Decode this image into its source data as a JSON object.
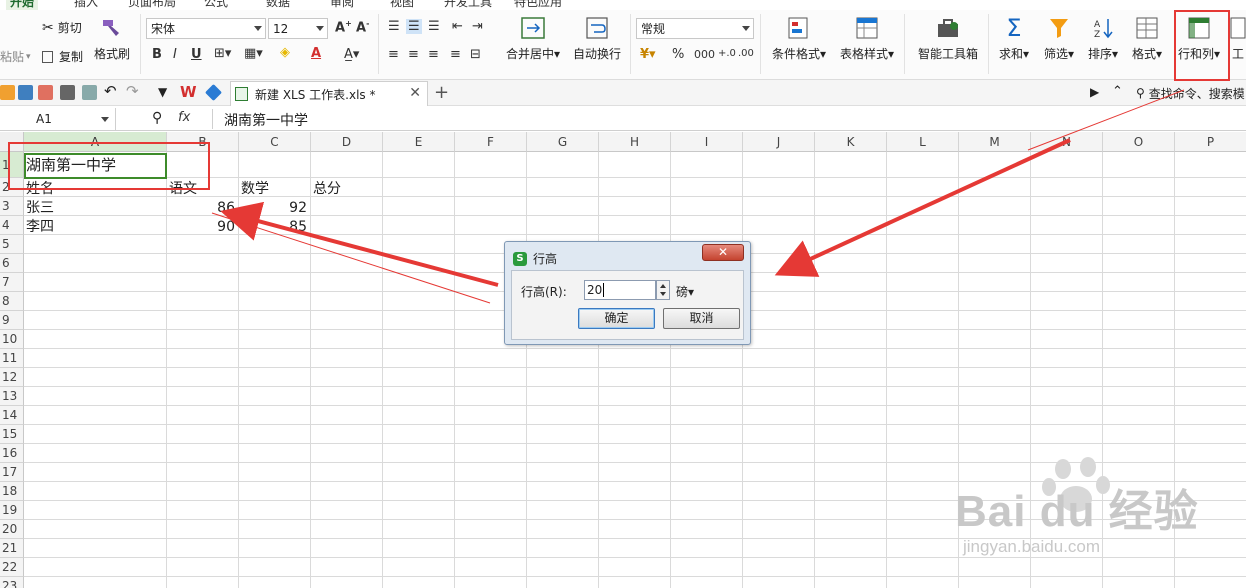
{
  "ribbon_tabs": [
    "开始",
    "插入",
    "页面布局",
    "公式",
    "数据",
    "审阅",
    "视图",
    "开发工具",
    "特色应用"
  ],
  "ribbon": {
    "cut": "剪切",
    "copy": "复制",
    "format_painter": "格式刷",
    "paste": "粘贴",
    "font_name": "宋体",
    "font_size": "12",
    "merge_center": "合并居中",
    "wrap_text": "自动换行",
    "number_format": "常规",
    "percent": "%",
    "conditional_format": "条件格式",
    "table_style": "表格样式",
    "smart_toolbox": "智能工具箱",
    "sum": "求和",
    "filter": "筛选",
    "sort": "排序",
    "format": "格式",
    "row_col": "行和列",
    "worksheet": "工"
  },
  "doc_tab": {
    "title": "新建 XLS 工作表.xls *"
  },
  "search": {
    "text": "查找命令、搜索模"
  },
  "formula_bar": {
    "name_box": "A1",
    "fx": "fx",
    "value": "湖南第一中学"
  },
  "columns": [
    "A",
    "B",
    "C",
    "D",
    "E",
    "F",
    "G",
    "H",
    "I",
    "J",
    "K",
    "L",
    "M",
    "N",
    "O",
    "P"
  ],
  "rows": [
    "1",
    "2",
    "3",
    "4",
    "5",
    "6",
    "7",
    "8",
    "9",
    "10",
    "11",
    "12",
    "13",
    "14",
    "15",
    "16",
    "17",
    "18",
    "19",
    "20",
    "21",
    "22",
    "23"
  ],
  "cells": {
    "a1": "湖南第一中学",
    "a2": "姓名",
    "b2": "语文",
    "c2": "数学",
    "d2": "总分",
    "a3": "张三",
    "b3": "86",
    "c3": "92",
    "a4": "李四",
    "b4": "90",
    "c4": "85"
  },
  "dialog": {
    "title": "行高",
    "label": "行高(R):",
    "value": "20",
    "unit": "磅",
    "ok": "确定",
    "cancel": "取消"
  },
  "watermark": {
    "brand": "Bai du 经验",
    "site": "jingyan.baidu.com"
  },
  "colors": {
    "accent_green": "#3d8b2a",
    "annotation_red": "#e53935",
    "selected_header": "#d7ebd2"
  }
}
